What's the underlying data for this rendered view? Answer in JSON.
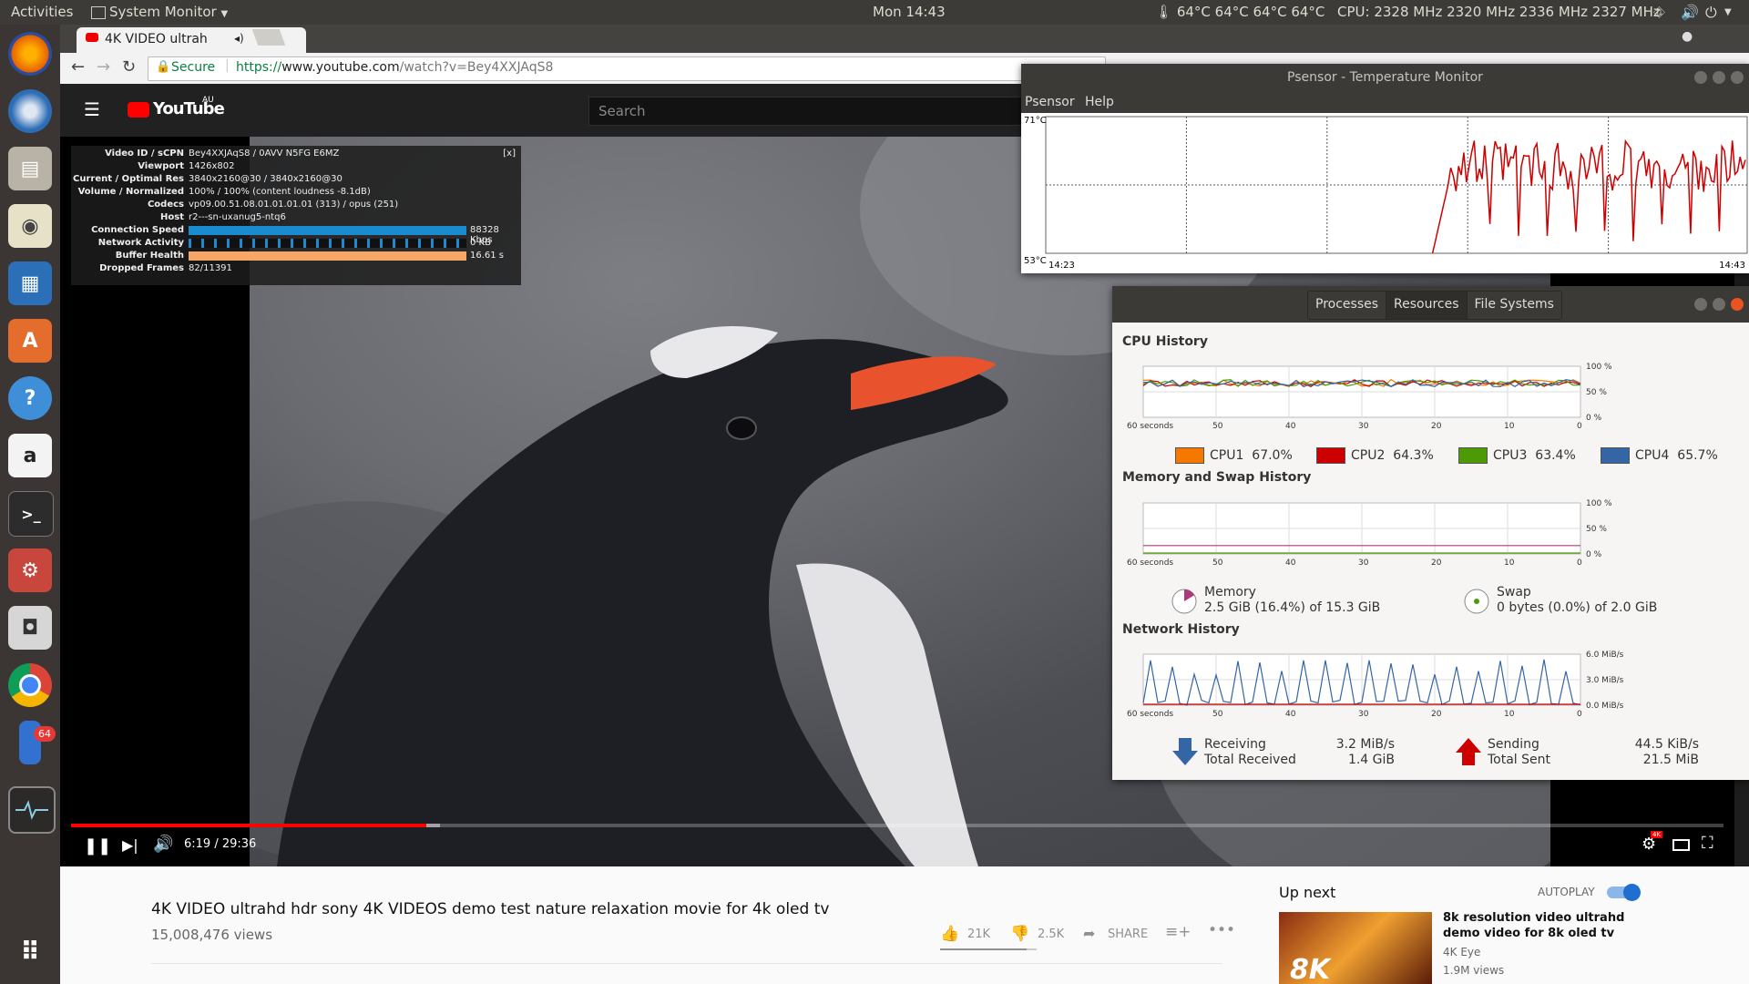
{
  "top_panel": {
    "activities": "Activities",
    "app_menu": "System Monitor",
    "clock": "Mon 14:43",
    "temps": "64°C 64°C 64°C 64°C",
    "cpu_freq": "CPU: 2328 MHz 2320 MHz 2336 MHz 2327 MHz"
  },
  "launcher": {
    "badge_count": "64",
    "icons": [
      "firefox-icon",
      "thunderbird-icon",
      "files-icon",
      "rhythmbox-icon",
      "libreoffice-writer-icon",
      "software-center-icon",
      "help-icon",
      "amazon-icon",
      "terminal-icon",
      "system-settings-icon",
      "screenshot-icon",
      "chrome-icon",
      "psensor-icon",
      "system-monitor-icon",
      "show-apps-icon"
    ]
  },
  "browser": {
    "tab_title": "4K VIDEO ultrah",
    "secure_label": "Secure",
    "url_scheme": "https://",
    "url_host": "www.youtube.com",
    "url_path": "/watch?v=Bey4XXJAqS8"
  },
  "youtube": {
    "logo_text": "YouTube",
    "region": "AU",
    "search_placeholder": "Search",
    "stats": {
      "close": "[x]",
      "rows": [
        {
          "label": "Video ID / sCPN",
          "value": "Bey4XXJAqS8 / 0AVV N5FG E6MZ"
        },
        {
          "label": "Viewport",
          "value": "1426x802"
        },
        {
          "label": "Current / Optimal Res",
          "value": "3840x2160@30 / 3840x2160@30"
        },
        {
          "label": "Volume / Normalized",
          "value": "100% / 100% (content loudness -8.1dB)"
        },
        {
          "label": "Codecs",
          "value": "vp09.00.51.08.01.01.01.01 (313) / opus (251)"
        },
        {
          "label": "Host",
          "value": "r2---sn-uxanug5-ntq6"
        },
        {
          "label": "Connection Speed",
          "value": "88328 Kbps"
        },
        {
          "label": "Network Activity",
          "value": "0 KB"
        },
        {
          "label": "Buffer Health",
          "value": "16.61 s"
        },
        {
          "label": "Dropped Frames",
          "value": "82/11391"
        }
      ]
    },
    "progress_fraction": 0.2149,
    "buffered_fraction": 0.223,
    "time": "6:19 / 29:36",
    "quality_badge": "4K",
    "video_title": "4K VIDEO ultrahd hdr sony 4K VIDEOS demo test nature relaxation movie for 4k oled tv",
    "views": "15,008,476 views",
    "likes": "21K",
    "dislikes": "2.5K",
    "share": "SHARE",
    "like_fraction": 0.894,
    "up_next": "Up next",
    "autoplay": "AUTOPLAY",
    "next_video": {
      "title": "8k resolution video ultrahd demo video for 8k oled tv",
      "channel": "4K Eye",
      "views": "1.9M views",
      "thumb_text": "8K"
    }
  },
  "psensor": {
    "title": "Psensor - Temperature Monitor",
    "menu": [
      "Psensor",
      "Help"
    ],
    "y_max": "71°C",
    "y_min": "53°C",
    "x_start": "14:23",
    "x_end": "14:43",
    "series_color": "#cc0000"
  },
  "sysmon": {
    "tabs": [
      "Processes",
      "Resources",
      "File Systems"
    ],
    "cpu_header": "CPU History",
    "mem_header": "Memory and Swap History",
    "net_header": "Network History",
    "x_ticks": [
      "60 seconds",
      "50",
      "40",
      "30",
      "20",
      "10",
      "0"
    ],
    "pct_ticks": [
      "100 %",
      "50 %",
      "0 %"
    ],
    "net_ticks": [
      "6.0 MiB/s",
      "3.0 MiB/s",
      "0.0 MiB/s"
    ],
    "cpus": [
      {
        "name": "CPU1",
        "value": "67.0%",
        "color": "#f57900"
      },
      {
        "name": "CPU2",
        "value": "64.3%",
        "color": "#cc0000"
      },
      {
        "name": "CPU3",
        "value": "63.4%",
        "color": "#4e9a06"
      },
      {
        "name": "CPU4",
        "value": "65.7%",
        "color": "#3465a4"
      }
    ],
    "memory": {
      "label": "Memory",
      "value": "2.5 GiB (16.4%) of 15.3 GiB",
      "percent": 16.4,
      "color": "#ad3a7a"
    },
    "swap": {
      "label": "Swap",
      "value": "0 bytes (0.0%) of 2.0 GiB",
      "percent": 0.0,
      "color": "#4e9a06"
    },
    "receiving": {
      "label": "Receiving",
      "rate": "3.2 MiB/s",
      "total_label": "Total Received",
      "total": "1.4 GiB",
      "color": "#3465a4"
    },
    "sending": {
      "label": "Sending",
      "rate": "44.5 KiB/s",
      "total_label": "Total Sent",
      "total": "21.5 MiB",
      "color": "#cc0000"
    }
  }
}
